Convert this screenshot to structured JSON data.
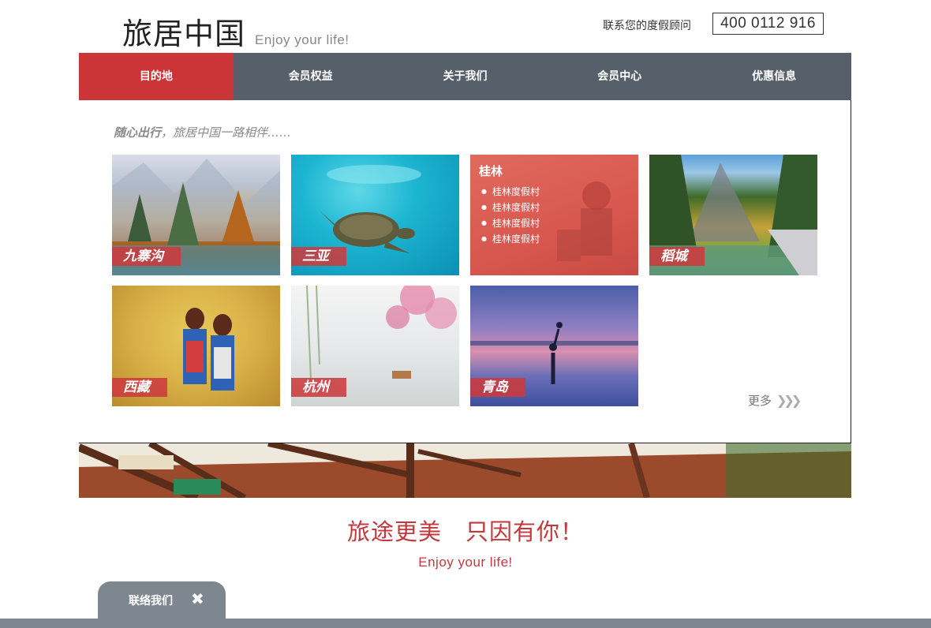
{
  "header": {
    "logo_cn": "旅居中国",
    "logo_en": "Enjoy your life!",
    "contact_label": "联系您的度假顾问",
    "phone": "400 0112 916"
  },
  "nav": {
    "items": [
      {
        "label": "目的地",
        "active": true
      },
      {
        "label": "会员权益",
        "active": false
      },
      {
        "label": "关于我们",
        "active": false
      },
      {
        "label": "会员中心",
        "active": false
      },
      {
        "label": "优惠信息",
        "active": false
      }
    ]
  },
  "content": {
    "tagline_bold": "随心出行",
    "tagline_rest": "，旅居中国一路相伴……",
    "destinations": [
      {
        "label": "九寨沟"
      },
      {
        "label": "三亚"
      },
      {
        "label": "桂林",
        "list": [
          "桂林度假村",
          "桂林度假村",
          "桂林度假村",
          "桂林度假村"
        ]
      },
      {
        "label": "稻城"
      },
      {
        "label": "西藏"
      },
      {
        "label": "杭州"
      },
      {
        "label": "青岛"
      }
    ],
    "more_label": "更多"
  },
  "footer": {
    "slogan": "旅途更美　只因有你！",
    "slogan_en": "Enjoy your life!",
    "contact_tab": "联络我们",
    "close_glyph": "✖"
  },
  "colors": {
    "accent": "#cc3538",
    "nav_bg": "#565f6a",
    "bar_gray": "#7e8690"
  }
}
